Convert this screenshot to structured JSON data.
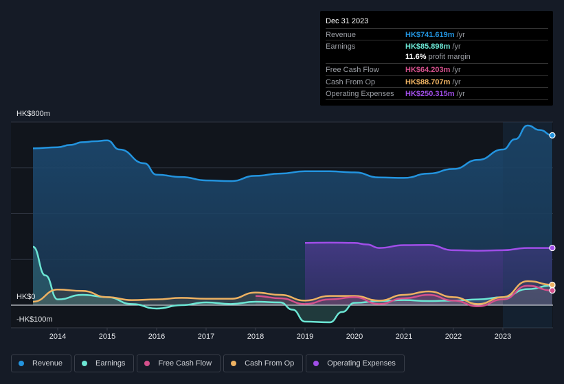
{
  "tooltip": {
    "date": "Dec 31 2023",
    "rows": [
      {
        "label": "Revenue",
        "value": "HK$741.619m",
        "unit": "/yr",
        "color": "#2394df"
      },
      {
        "label": "Earnings",
        "value": "HK$85.898m",
        "unit": "/yr",
        "color": "#6ce6d4"
      },
      {
        "label": "Free Cash Flow",
        "value": "HK$64.203m",
        "unit": "/yr",
        "color": "#d4508c"
      },
      {
        "label": "Cash From Op",
        "value": "HK$88.707m",
        "unit": "/yr",
        "color": "#eeb262"
      },
      {
        "label": "Operating Expenses",
        "value": "HK$250.315m",
        "unit": "/yr",
        "color": "#a04ee8"
      }
    ],
    "margin_value": "11.6%",
    "margin_label": "profit margin"
  },
  "legend": [
    {
      "label": "Revenue",
      "color": "#2394df"
    },
    {
      "label": "Earnings",
      "color": "#6ce6d4"
    },
    {
      "label": "Free Cash Flow",
      "color": "#d4508c"
    },
    {
      "label": "Cash From Op",
      "color": "#eeb262"
    },
    {
      "label": "Operating Expenses",
      "color": "#a04ee8"
    }
  ],
  "chart_data": {
    "type": "area",
    "title": "",
    "xlabel": "",
    "ylabel": "",
    "y_tick_labels": [
      "HK$800m",
      "HK$0",
      "-HK$100m"
    ],
    "y_ticks": [
      800,
      0,
      -100
    ],
    "ylim": [
      -100,
      800
    ],
    "xlim": [
      2013.5,
      2024.0
    ],
    "x_tick_labels": [
      "2014",
      "2015",
      "2016",
      "2017",
      "2018",
      "2019",
      "2020",
      "2021",
      "2022",
      "2023"
    ],
    "x_ticks": [
      2014,
      2015,
      2016,
      2017,
      2018,
      2019,
      2020,
      2021,
      2022,
      2023
    ],
    "grid": true,
    "legend_position": "bottom",
    "highlight_start": 2023.0,
    "series": [
      {
        "name": "Revenue",
        "color": "#2394df",
        "x": [
          2013.5,
          2014.0,
          2014.25,
          2014.5,
          2014.75,
          2015.0,
          2015.25,
          2015.75,
          2016.0,
          2016.5,
          2017.0,
          2017.5,
          2018.0,
          2018.5,
          2019.0,
          2019.5,
          2020.0,
          2020.5,
          2021.0,
          2021.5,
          2022.0,
          2022.5,
          2023.0,
          2023.25,
          2023.5,
          2023.75,
          2024.0
        ],
        "values": [
          685,
          690,
          700,
          712,
          716,
          720,
          680,
          620,
          570,
          560,
          545,
          542,
          565,
          575,
          585,
          585,
          580,
          558,
          556,
          575,
          595,
          635,
          680,
          725,
          785,
          765,
          742
        ]
      },
      {
        "name": "Earnings",
        "color": "#6ce6d4",
        "x": [
          2013.5,
          2013.75,
          2014.0,
          2014.5,
          2015.0,
          2015.5,
          2016.0,
          2016.5,
          2017.0,
          2017.5,
          2018.0,
          2018.5,
          2018.75,
          2019.0,
          2019.5,
          2019.75,
          2020.0,
          2020.5,
          2021.0,
          2021.5,
          2022.0,
          2022.5,
          2023.0,
          2023.5,
          2024.0
        ],
        "values": [
          255,
          130,
          25,
          45,
          35,
          5,
          -15,
          0,
          12,
          5,
          15,
          12,
          -20,
          -72,
          -75,
          -30,
          10,
          18,
          22,
          18,
          20,
          25,
          35,
          70,
          86
        ]
      },
      {
        "name": "Free Cash Flow",
        "color": "#d4508c",
        "x": [
          2018.0,
          2018.5,
          2019.0,
          2019.5,
          2020.0,
          2020.5,
          2021.0,
          2021.5,
          2022.0,
          2022.5,
          2023.0,
          2023.5,
          2024.0
        ],
        "values": [
          40,
          30,
          5,
          25,
          35,
          5,
          30,
          45,
          20,
          -5,
          25,
          85,
          64
        ]
      },
      {
        "name": "Cash From Op",
        "color": "#eeb262",
        "x": [
          2013.5,
          2014.0,
          2014.5,
          2015.0,
          2015.5,
          2016.0,
          2016.5,
          2017.0,
          2017.5,
          2018.0,
          2018.5,
          2019.0,
          2019.5,
          2020.0,
          2020.5,
          2021.0,
          2021.5,
          2022.0,
          2022.5,
          2023.0,
          2023.5,
          2024.0
        ],
        "values": [
          15,
          68,
          62,
          35,
          22,
          25,
          32,
          28,
          28,
          55,
          45,
          20,
          40,
          40,
          20,
          45,
          60,
          35,
          5,
          35,
          105,
          89
        ]
      },
      {
        "name": "Operating Expenses",
        "color": "#a04ee8",
        "x": [
          2019.0,
          2019.5,
          2020.0,
          2020.25,
          2020.5,
          2021.0,
          2021.5,
          2022.0,
          2022.5,
          2023.0,
          2023.5,
          2024.0
        ],
        "values": [
          272,
          273,
          272,
          265,
          250,
          262,
          263,
          240,
          238,
          240,
          250,
          250
        ]
      }
    ]
  }
}
